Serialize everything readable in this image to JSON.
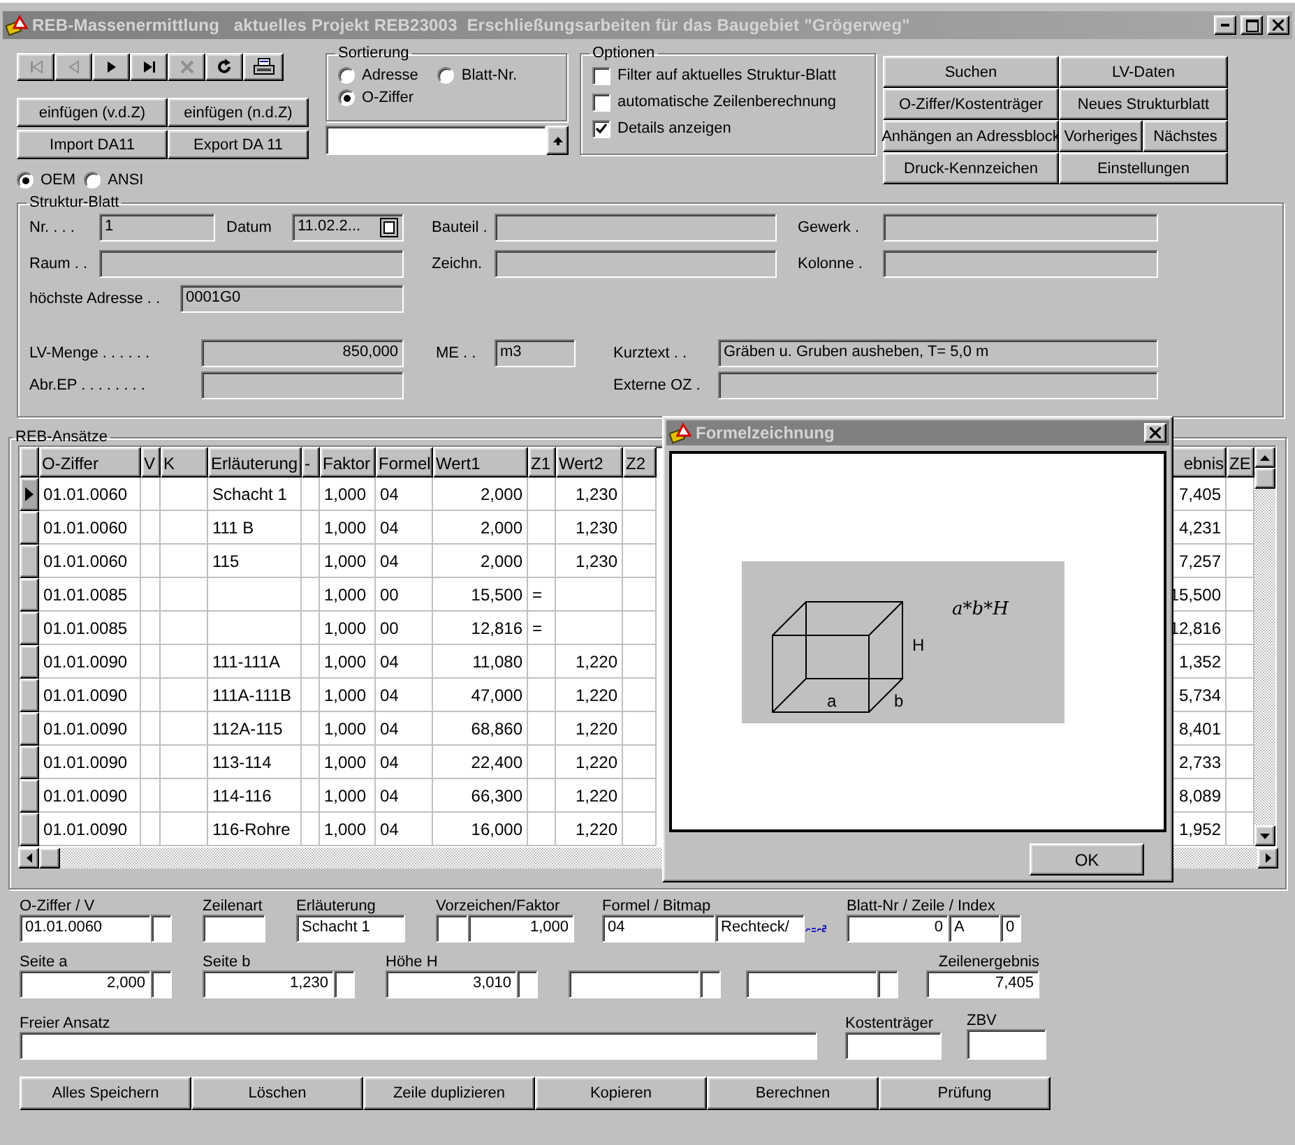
{
  "window": {
    "title": "REB-Massenermittlung   aktuelles Projekt REB23003  Erschließungsarbeiten für das Baugebiet \"Grögerweg\""
  },
  "nav_buttons": [
    {
      "kind": "first",
      "disabled": true
    },
    {
      "kind": "prev",
      "disabled": true
    },
    {
      "kind": "next",
      "disabled": false
    },
    {
      "kind": "last",
      "disabled": false
    },
    {
      "kind": "delete",
      "disabled": true
    },
    {
      "kind": "refresh",
      "disabled": false
    },
    {
      "kind": "print",
      "disabled": false
    }
  ],
  "edit_buttons": [
    [
      "einfügen (v.d.Z)",
      "einfügen (n.d.Z)"
    ],
    [
      "Import DA11",
      "Export DA 11"
    ]
  ],
  "sortierung": {
    "title": "Sortierung",
    "options": [
      {
        "label": "Adresse",
        "selected": false
      },
      {
        "label": "Blatt-Nr.",
        "selected": false
      },
      {
        "label": "O-Ziffer",
        "selected": true
      }
    ]
  },
  "optionen": {
    "title": "Optionen",
    "options": [
      {
        "label": "Filter auf aktuelles Struktur-Blatt",
        "checked": false
      },
      {
        "label": "automatische Zeilenberechnung",
        "checked": false
      },
      {
        "label": "Details anzeigen",
        "checked": true
      }
    ]
  },
  "command_buttons": [
    [
      "Suchen",
      "LV-Daten"
    ],
    [
      "O-Ziffer/Kostenträger",
      "Neues Strukturblatt"
    ],
    [
      "Anhängen an Adressblock",
      "Vorheriges",
      "Nächstes"
    ],
    [
      "Druck-Kennzeichen",
      "Einstellungen"
    ]
  ],
  "encoding": [
    {
      "label": "OEM",
      "selected": true
    },
    {
      "label": "ANSI",
      "selected": false
    }
  ],
  "struktur_blatt": {
    "title": "Struktur-Blatt",
    "nr": {
      "label": "Nr. . . .",
      "value": "1"
    },
    "datum": {
      "label": "Datum",
      "value": "11.02.2..."
    },
    "bauteil": {
      "label": "Bauteil ."
    },
    "gewerk": {
      "label": "Gewerk ."
    },
    "raum": {
      "label": "Raum . ."
    },
    "zeichn": {
      "label": "Zeichn."
    },
    "kolonne": {
      "label": "Kolonne ."
    },
    "adresse": {
      "label": "höchste Adresse . .",
      "value": "0001G0"
    },
    "lv_menge": {
      "label": "LV-Menge . . . . . .",
      "value": "850,000"
    },
    "me": {
      "label": "ME . .",
      "value": "m3"
    },
    "kurztext": {
      "label": "Kurztext . .",
      "value": "Gräben u. Gruben ausheben, T= 5,0 m"
    },
    "abr_ep": {
      "label": "Abr.EP . . . . . . . ."
    },
    "externe_oz": {
      "label": "Externe OZ ."
    }
  },
  "table": {
    "title": "REB-Ansätze",
    "columns": [
      "O-Ziffer",
      "V",
      "K",
      "Erläuterung",
      "-",
      "Faktor",
      "Formel",
      "Wert1",
      "Z1",
      "Wert2",
      "Z2",
      "ebnis",
      "ZE"
    ],
    "rows": [
      {
        "selected": true,
        "o_ziffer": "01.01.0060",
        "erl": "Schacht 1",
        "faktor": "1,000",
        "formel": "04",
        "wert1": "2,000",
        "wert2": "1,230",
        "ergebnis": "7,405"
      },
      {
        "selected": false,
        "o_ziffer": "01.01.0060",
        "erl": "111 B",
        "faktor": "1,000",
        "formel": "04",
        "wert1": "2,000",
        "wert2": "1,230",
        "ergebnis": "4,231"
      },
      {
        "selected": false,
        "o_ziffer": "01.01.0060",
        "erl": "115",
        "faktor": "1,000",
        "formel": "04",
        "wert1": "2,000",
        "wert2": "1,230",
        "ergebnis": "7,257"
      },
      {
        "selected": false,
        "o_ziffer": "01.01.0085",
        "faktor": "1,000",
        "formel": "00",
        "wert1": "15,500",
        "z1": "=",
        "ergebnis": "15,500"
      },
      {
        "selected": false,
        "o_ziffer": "01.01.0085",
        "faktor": "1,000",
        "formel": "00",
        "wert1": "12,816",
        "z1": "=",
        "ergebnis": "12,816"
      },
      {
        "selected": false,
        "o_ziffer": "01.01.0090",
        "erl": "111-111A",
        "faktor": "1,000",
        "formel": "04",
        "wert1": "11,080",
        "wert2": "1,220",
        "ergebnis": "1,352"
      },
      {
        "selected": false,
        "o_ziffer": "01.01.0090",
        "erl": "111A-111B",
        "faktor": "1,000",
        "formel": "04",
        "wert1": "47,000",
        "wert2": "1,220",
        "ergebnis": "5,734"
      },
      {
        "selected": false,
        "o_ziffer": "01.01.0090",
        "erl": "112A-115",
        "faktor": "1,000",
        "formel": "04",
        "wert1": "68,860",
        "wert2": "1,220",
        "ergebnis": "8,401"
      },
      {
        "selected": false,
        "o_ziffer": "01.01.0090",
        "erl": "113-114",
        "faktor": "1,000",
        "formel": "04",
        "wert1": "22,400",
        "wert2": "1,220",
        "ergebnis": "2,733"
      },
      {
        "selected": false,
        "o_ziffer": "01.01.0090",
        "erl": "114-116",
        "faktor": "1,000",
        "formel": "04",
        "wert1": "66,300",
        "wert2": "1,220",
        "ergebnis": "8,089"
      },
      {
        "selected": false,
        "o_ziffer": "01.01.0090",
        "erl": "116-Rohre",
        "faktor": "1,000",
        "formel": "04",
        "wert1": "16,000",
        "wert2": "1,220",
        "ergebnis": "1,952"
      }
    ]
  },
  "dialog": {
    "title": "Formelzeichnung",
    "formula": "a*b*H",
    "height_label": "H",
    "width_label": "a",
    "depth_label": "b",
    "button": "OK"
  },
  "detail": {
    "o_ziffer": {
      "label": "O-Ziffer / V",
      "value": "01.01.0060"
    },
    "zeilenart": {
      "label": "Zeilenart"
    },
    "erlaeuterung": {
      "label": "Erläuterung",
      "value": "Schacht 1"
    },
    "faktor": {
      "label": "Vorzeichen/Faktor",
      "value": "1,000"
    },
    "formel": {
      "label": "Formel / Bitmap",
      "value": "04",
      "bitmap": "Rechteck/"
    },
    "blatt": {
      "label": "Blatt-Nr / Zeile / Index",
      "blatt": "0",
      "zeile": "A",
      "index": "0"
    },
    "seite_a": {
      "label": "Seite a",
      "value": "2,000"
    },
    "seite_b": {
      "label": "Seite b",
      "value": "1,230"
    },
    "hoehe": {
      "label": "Höhe H",
      "value": "3,010"
    },
    "zeilenergebnis": {
      "label": "Zeilenergebnis",
      "value": "7,405"
    },
    "freier_ansatz": {
      "label": "Freier Ansatz"
    },
    "kostentraeger": {
      "label": "Kostenträger"
    },
    "zbv": {
      "label": "ZBV"
    }
  },
  "footer_buttons": [
    "Alles Speichern",
    "Löschen",
    "Zeile duplizieren",
    "Kopieren",
    "Berechnen",
    "Prüfung"
  ]
}
